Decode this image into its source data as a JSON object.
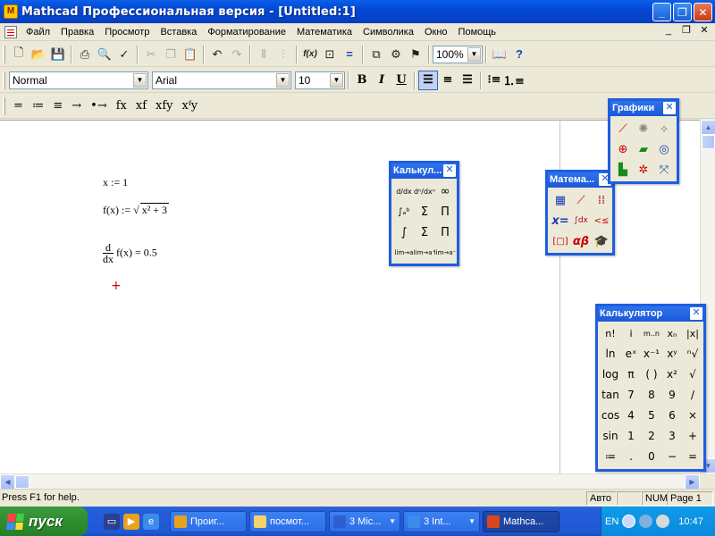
{
  "window": {
    "title": "Mathcad Профессиональная версия - [Untitled:1]",
    "app_icon_glyph": "M",
    "minimize": "_",
    "maximize": "❐",
    "close": "✕"
  },
  "menubar": {
    "items": [
      "Файл",
      "Правка",
      "Просмотр",
      "Вставка",
      "Форматирование",
      "Математика",
      "Символика",
      "Окно",
      "Помощь"
    ],
    "mdi_min": "_",
    "mdi_restore": "❐",
    "mdi_close": "✕"
  },
  "standard_toolbar": {
    "zoom": "100%",
    "fx_label": "f(x)",
    "help_glyph": "?"
  },
  "format_toolbar": {
    "style": "Normal",
    "font": "Arial",
    "size": "10",
    "bold": "B",
    "italic": "I",
    "underline": "U"
  },
  "operators_toolbar": {
    "items": [
      "=",
      "≔",
      "≡",
      "→",
      "•→",
      "fx",
      "xf",
      "xfy",
      "xᶠy"
    ]
  },
  "worksheet": {
    "line1": "x := 1",
    "line2_lhs": "f(x) :=",
    "line2_radicand": "x² + 3",
    "line3_num": "d",
    "line3_den": "dx",
    "line3_rest": "f(x) = 0.5",
    "cursor": "+"
  },
  "palettes": {
    "calculus": {
      "title": "Калькул...",
      "cells": [
        "d/dx",
        "dⁿ/dxⁿ",
        "∞",
        "∫ₐᵇ",
        "Σ",
        "Π",
        "∫",
        "Σ",
        "Π",
        "lim→a",
        "lim→a⁺",
        "lim→a⁻"
      ]
    },
    "math": {
      "title": "Матема...",
      "cells": [
        "calc-icon",
        "graph-icon",
        "matrix-icon",
        "x=",
        "∫dx",
        "<≤",
        "[□]",
        "αβ",
        "cap-icon"
      ]
    },
    "graph": {
      "title": "Графики",
      "cells": [
        "xy-plot",
        "polar-plot",
        "surface-plot",
        "contour-plot",
        "3d-scatter",
        "vector-plot",
        "3d-bar",
        "scatter-3d",
        "plot-wizard"
      ]
    },
    "calculator": {
      "title": "Калькулятор",
      "cells": [
        "n!",
        "i",
        "m..n",
        "xₙ",
        "|x|",
        "ln",
        "eˣ",
        "x⁻¹",
        "xʸ",
        "ⁿ√",
        "log",
        "π",
        "( )",
        "x²",
        "√",
        "tan",
        "7",
        "8",
        "9",
        "/",
        "cos",
        "4",
        "5",
        "6",
        "×",
        "sin",
        "1",
        "2",
        "3",
        "+",
        "≔",
        ".",
        "0",
        "−",
        "="
      ]
    }
  },
  "statusbar": {
    "help": "Press F1 for help.",
    "mode": "Авто",
    "num": "NUM",
    "page": "Page 1"
  },
  "taskbar": {
    "start": "пуск",
    "tasks": [
      {
        "label": "Проиг...",
        "color": "#e9a21e"
      },
      {
        "label": "посмот...",
        "color": "#f3d36a"
      },
      {
        "label": "3 Mic...",
        "color": "#2f5fcf"
      },
      {
        "label": "3 Int...",
        "color": "#3a8de8"
      },
      {
        "label": "Mathca...",
        "color": "#d9471c"
      }
    ],
    "lang": "EN",
    "time": "10:47"
  },
  "colors": {
    "title_blue": "#0348d4",
    "palette_border": "#1e5ee0",
    "start_green": "#2f8f2f",
    "cursor_red": "#dd0000"
  }
}
